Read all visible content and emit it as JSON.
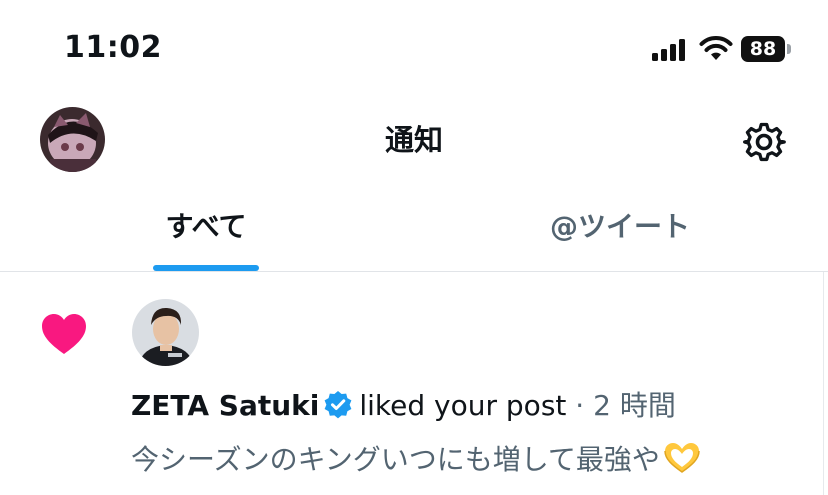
{
  "status_bar": {
    "time": "11:02",
    "battery_level": "88",
    "icons": [
      "signal-icon",
      "wifi-icon",
      "battery-icon"
    ]
  },
  "header": {
    "title": "通知",
    "icons": [
      "avatar",
      "gear-icon"
    ]
  },
  "tabs": [
    {
      "label": "すべて",
      "selected": true
    },
    {
      "label": "@ツイート",
      "selected": false
    }
  ],
  "notifications": [
    {
      "type_icon": "heart-icon",
      "user_name": "ZETA Satuki",
      "verified": true,
      "action": "liked your post",
      "separator": "·",
      "time": "2 時間",
      "post_text": "今シーズンのキングいつにも増して最強や",
      "post_emoji": "heart-hands-emoji"
    }
  ],
  "colors": {
    "accent": "#1d9bf0",
    "like": "#f91880",
    "text_primary": "#0f1419",
    "text_secondary": "#536471"
  }
}
